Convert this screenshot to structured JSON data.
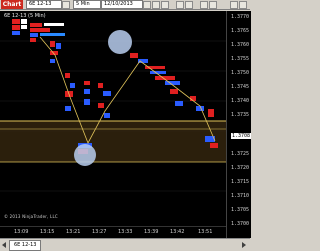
{
  "toolbar": {
    "chart_button": "Chart",
    "symbol_field": "6E 12-13",
    "interval_field": "5 Min",
    "date_field": "12/10/2013"
  },
  "chart": {
    "symbol_label": "6E 12-13 (5 Min)",
    "footnote": "© 2013 NinjaTrader, LLC",
    "price_labels": [
      "1.3770",
      "1.3765",
      "1.3760",
      "1.3755",
      "1.3750",
      "1.3745",
      "1.3740",
      "1.3735",
      "1.3730",
      "1.3725",
      "1.3720",
      "1.3715",
      "1.3710",
      "1.3705",
      "1.3700"
    ],
    "current_price": "1.3708",
    "time_labels": [
      "13:09",
      "13:15",
      "13:21",
      "13:27",
      "13:33",
      "13:39",
      "13:42",
      "13:51"
    ]
  },
  "tabbar": {
    "active_tab": "6E 12-13"
  },
  "colors": {
    "background": "#000000",
    "bid": "#e02020",
    "ask": "#2a5cff",
    "band": "#e0c35a",
    "marker": "#b8cef0"
  }
}
